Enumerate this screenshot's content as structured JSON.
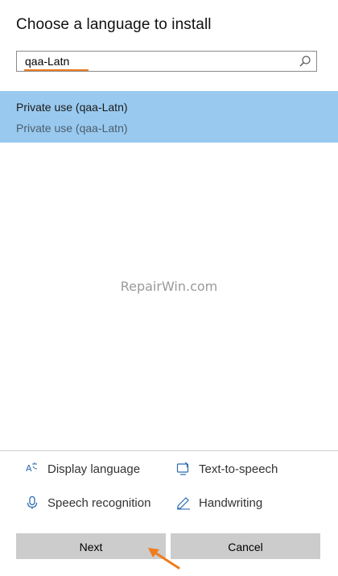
{
  "dialog": {
    "title": "Choose a language to install"
  },
  "search": {
    "value": "qaa-Latn",
    "placeholder": "",
    "icon": "search-icon",
    "highlight_color": "#f07c1e"
  },
  "results": [
    {
      "name": "Private use (qaa-Latn)",
      "subtitle": "Private use (qaa-Latn)",
      "selected": true
    }
  ],
  "selection_color": "#99c9ef",
  "watermark": "RepairWin.com",
  "features": [
    {
      "icon": "display-language-icon",
      "label": "Display language"
    },
    {
      "icon": "text-to-speech-icon",
      "label": "Text-to-speech"
    },
    {
      "icon": "microphone-icon",
      "label": "Speech recognition"
    },
    {
      "icon": "pen-icon",
      "label": "Handwriting"
    }
  ],
  "buttons": {
    "next_label": "Next",
    "cancel_label": "Cancel"
  },
  "annotation_color": "#f07c1e"
}
